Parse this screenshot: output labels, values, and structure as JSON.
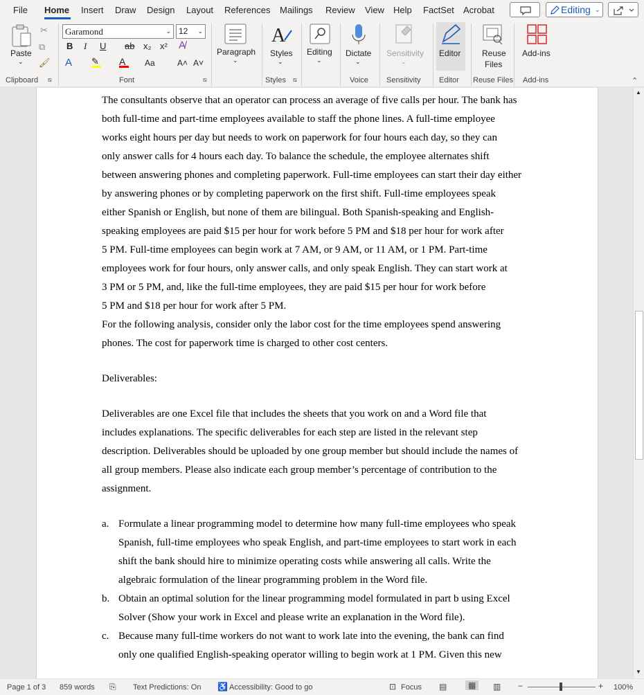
{
  "menu": [
    "File",
    "Home",
    "Insert",
    "Draw",
    "Design",
    "Layout",
    "References",
    "Mailings",
    "Review",
    "View",
    "Help",
    "FactSet",
    "Acrobat"
  ],
  "header": {
    "editing_label": "Editing"
  },
  "ribbon": {
    "paste": "Paste",
    "font_name": "Garamond",
    "font_size": "12",
    "paragraph": "Paragraph",
    "styles": "Styles",
    "editing": "Editing",
    "dictate": "Dictate",
    "sensitivity": "Sensitivity",
    "editor": "Editor",
    "reuse": "Reuse",
    "files": "Files",
    "addins": "Add-ins",
    "groups": {
      "clipboard": "Clipboard",
      "font": "Font",
      "styles": "Styles",
      "voice": "Voice",
      "sensitivity": "Sensitivity",
      "editor": "Editor",
      "reuse_files": "Reuse Files",
      "addins": "Add-ins"
    },
    "tools": {
      "bold": "B",
      "italic": "I",
      "underline": "U",
      "strike": "ab",
      "subscript": "x₂",
      "superscript": "x²",
      "case": "Aa",
      "grow": "A˄",
      "shrink": "A˅"
    }
  },
  "document": {
    "para1": [
      "The consultants observe that an operator can process an average of five calls per hour. The bank has",
      "both full-time and part-time employees available to staff the phone lines. A full-time employee",
      "works eight hours per day but needs to work on paperwork for four hours each day, so they can",
      "only answer calls for 4 hours each day. To balance the schedule, the employee alternates shift",
      "between answering phones and completing paperwork. Full-time employees can start their day either",
      "by answering phones or by completing paperwork on the first shift. Full-time employees speak",
      "either Spanish or English, but none of them are bilingual. Both Spanish-speaking and English-",
      "speaking employees are paid $15 per hour for work before 5 PM and $18 per hour for work after",
      "5 PM. Full-time employees can begin work at 7 AM, or 9 AM, or 11 AM, or 1 PM. Part-time",
      "employees work for four hours, only answer calls, and only speak English. They can start work at",
      "3 PM or 5 PM, and, like the full-time employees, they are paid $15 per hour for work before",
      "5 PM and $18 per hour for work after 5 PM."
    ],
    "para2": [
      "For the following analysis, consider only the labor cost for the time employees spend answering",
      "phones. The cost for paperwork time is charged to other cost centers."
    ],
    "deliverables_heading": "Deliverables:",
    "para3": [
      "Deliverables are one Excel file that includes the sheets that you work on and a Word file that",
      "includes explanations. The specific deliverables for each step are listed in the relevant step",
      "description. Deliverables should be uploaded by one group member but should include the names of",
      "all group members. Please also indicate each group member’s percentage of contribution to the",
      "assignment."
    ],
    "items": [
      {
        "marker": "a.",
        "lines": [
          "Formulate a linear programming model to determine how many full-time employees who speak",
          "Spanish, full-time employees who speak English, and part-time employees to start work in each",
          "shift the bank should hire to minimize operating costs while answering all calls. Write the",
          "algebraic formulation of the linear programming problem in the Word file."
        ]
      },
      {
        "marker": "b.",
        "lines": [
          "Obtain an optimal solution for the linear programming model formulated in part b using Excel",
          "Solver (Show your work in Excel and please write an explanation in the Word file)."
        ]
      },
      {
        "marker": "c.",
        "lines": [
          "Because many full-time workers do not want to work late into the evening, the bank can find",
          "only one qualified English-speaking operator willing to begin work at 1 PM. Given this new"
        ]
      }
    ]
  },
  "status": {
    "page": "Page 1 of 3",
    "words": "859 words",
    "text_predictions": "Text Predictions: On",
    "accessibility": "Accessibility: Good to go",
    "focus": "Focus",
    "zoom": "100%"
  },
  "colors": {
    "accent": "#185abd",
    "highlight": "#ffff00",
    "font_color": "#ff0000"
  }
}
